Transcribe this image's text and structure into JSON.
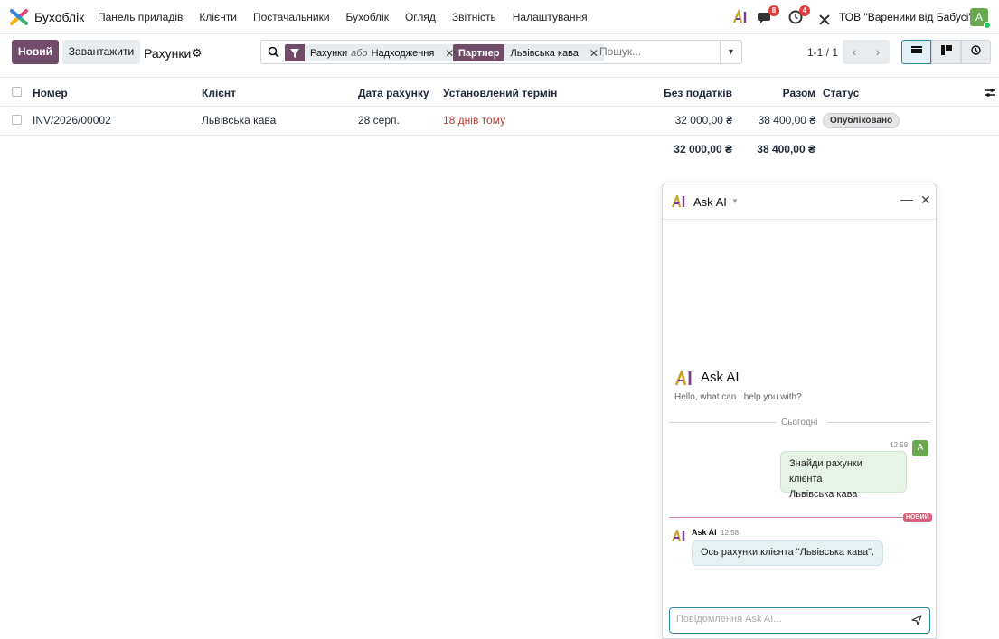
{
  "navbar": {
    "app_name": "Бухоблік",
    "menu": [
      "Панель приладів",
      "Клієнти",
      "Постачальники",
      "Бухоблік",
      "Огляд",
      "Звітність",
      "Налаштування"
    ],
    "messages_count": "8",
    "activities_count": "4",
    "company": "ТОВ \"Вареники від Бабусі\"",
    "avatar_letter": "A"
  },
  "control": {
    "new_label": "Новий",
    "upload_label": "Завантажити",
    "breadcrumb": "Рахунки",
    "facet1_values": [
      "Рахунки",
      "або",
      "Надходження"
    ],
    "facet2_tag": "Партнер",
    "facet2_value": "Львівська кава",
    "search_placeholder": "Пошук...",
    "pager": "1-1 / 1"
  },
  "table": {
    "headers": {
      "number": "Номер",
      "client": "Клієнт",
      "date": "Дата рахунку",
      "due": "Установлений термін",
      "untaxed": "Без податків",
      "total": "Разом",
      "status": "Статус"
    },
    "rows": [
      {
        "number": "INV/2026/00002",
        "client": "Львівська кава",
        "date": "28 серп.",
        "due": "18 днів тому",
        "untaxed": "32 000,00 ₴",
        "total": "38 400,00 ₴",
        "status": "Опубліковано"
      }
    ],
    "totals": {
      "untaxed": "32 000,00 ₴",
      "total": "38 400,00 ₴"
    }
  },
  "chat": {
    "title": "Ask AI",
    "intro_title": "Ask AI",
    "intro_sub": "Hello, what can I help you with?",
    "separator": "Сьогодні",
    "user_time": "12:58",
    "user_avatar": "A",
    "user_msg_line1": "Знайди рахунки клієнта",
    "user_msg_line2": "Львівська кава",
    "new_tag": "НОВИЙ",
    "ai_name": "Ask AI",
    "ai_time": "12:58",
    "ai_msg": "Ось рахунки клієнта \"Львівська кава\".",
    "composer_placeholder": "Повідомлення Ask AI..."
  },
  "colors": {
    "brand": "#714b67",
    "accent": "#2a8c9e",
    "overdue": "#c0392b"
  }
}
